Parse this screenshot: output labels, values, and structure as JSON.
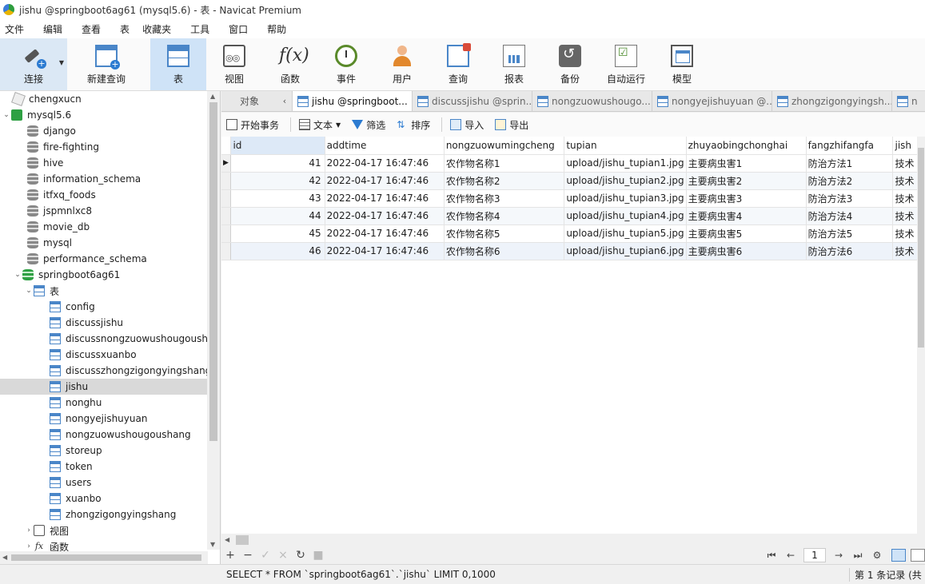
{
  "window": {
    "title": "jishu @springboot6ag61 (mysql5.6) - 表 - Navicat Premium"
  },
  "menu": [
    "文件",
    "编辑",
    "查看",
    "表",
    "收藏夹",
    "工具",
    "窗口",
    "帮助"
  ],
  "toolbar": {
    "connect": "连接",
    "new_query": "新建查询",
    "items": [
      {
        "label": "表",
        "icon": "table-icon",
        "active": true
      },
      {
        "label": "视图",
        "icon": "view-icon"
      },
      {
        "label": "函数",
        "icon": "function-icon"
      },
      {
        "label": "事件",
        "icon": "event-clock-icon"
      },
      {
        "label": "用户",
        "icon": "user-icon"
      },
      {
        "label": "查询",
        "icon": "query-icon"
      },
      {
        "label": "报表",
        "icon": "report-icon"
      },
      {
        "label": "备份",
        "icon": "backup-icon"
      },
      {
        "label": "自动运行",
        "icon": "auto-run-icon"
      },
      {
        "label": "模型",
        "icon": "model-icon"
      }
    ]
  },
  "sidebar": {
    "connections": [
      {
        "name": "chengxucn"
      },
      {
        "name": "mysql5.6"
      }
    ],
    "databases": [
      "django",
      "fire-fighting",
      "hive",
      "information_schema",
      "itfxq_foods",
      "jspmnlxc8",
      "movie_db",
      "mysql",
      "performance_schema"
    ],
    "open_db": "springboot6ag61",
    "tables_label": "表",
    "tables": [
      "config",
      "discussjishu",
      "discussnongzuowushougoushang",
      "discussxuanbo",
      "discusszhongzigongyingshang",
      "jishu",
      "nonghu",
      "nongyejishuyuan",
      "nongzuowushougoushang",
      "storeup",
      "token",
      "users",
      "xuanbo",
      "zhongzigongyingshang"
    ],
    "selected_table": "jishu",
    "views_label": "视图",
    "functions_label": "函数"
  },
  "tabs": {
    "objects": "对象",
    "items": [
      {
        "label": "jishu @springboot...",
        "active": true
      },
      {
        "label": "discussjishu @sprin..."
      },
      {
        "label": "nongzuowushougo..."
      },
      {
        "label": "nongyejishuyuan @..."
      },
      {
        "label": "zhongzigongyingsh..."
      },
      {
        "label": "n"
      }
    ]
  },
  "subtoolbar": {
    "begin_txn": "开始事务",
    "text": "文本",
    "filter": "筛选",
    "sort": "排序",
    "import": "导入",
    "export": "导出"
  },
  "grid": {
    "columns": [
      "id",
      "addtime",
      "nongzuowumingcheng",
      "tupian",
      "zhuyaobingchonghai",
      "fangzhifangfa",
      "jish"
    ],
    "rows": [
      [
        "41",
        "2022-04-17 16:47:46",
        "农作物名称1",
        "upload/jishu_tupian1.jpg",
        "主要病虫害1",
        "防治方法1",
        "技术"
      ],
      [
        "42",
        "2022-04-17 16:47:46",
        "农作物名称2",
        "upload/jishu_tupian2.jpg",
        "主要病虫害2",
        "防治方法2",
        "技术"
      ],
      [
        "43",
        "2022-04-17 16:47:46",
        "农作物名称3",
        "upload/jishu_tupian3.jpg",
        "主要病虫害3",
        "防治方法3",
        "技术"
      ],
      [
        "44",
        "2022-04-17 16:47:46",
        "农作物名称4",
        "upload/jishu_tupian4.jpg",
        "主要病虫害4",
        "防治方法4",
        "技术"
      ],
      [
        "45",
        "2022-04-17 16:47:46",
        "农作物名称5",
        "upload/jishu_tupian5.jpg",
        "主要病虫害5",
        "防治方法5",
        "技术"
      ],
      [
        "46",
        "2022-04-17 16:47:46",
        "农作物名称6",
        "upload/jishu_tupian6.jpg",
        "主要病虫害6",
        "防治方法6",
        "技术"
      ]
    ]
  },
  "pager": {
    "page": "1"
  },
  "status": {
    "sql": "SELECT * FROM `springboot6ag61`.`jishu` LIMIT 0,1000",
    "records": "第 1 条记录 (共"
  },
  "colors": {
    "accent": "#2c7bd1",
    "selected_tool": "#cfe3f7",
    "green_db": "#2ea043"
  }
}
